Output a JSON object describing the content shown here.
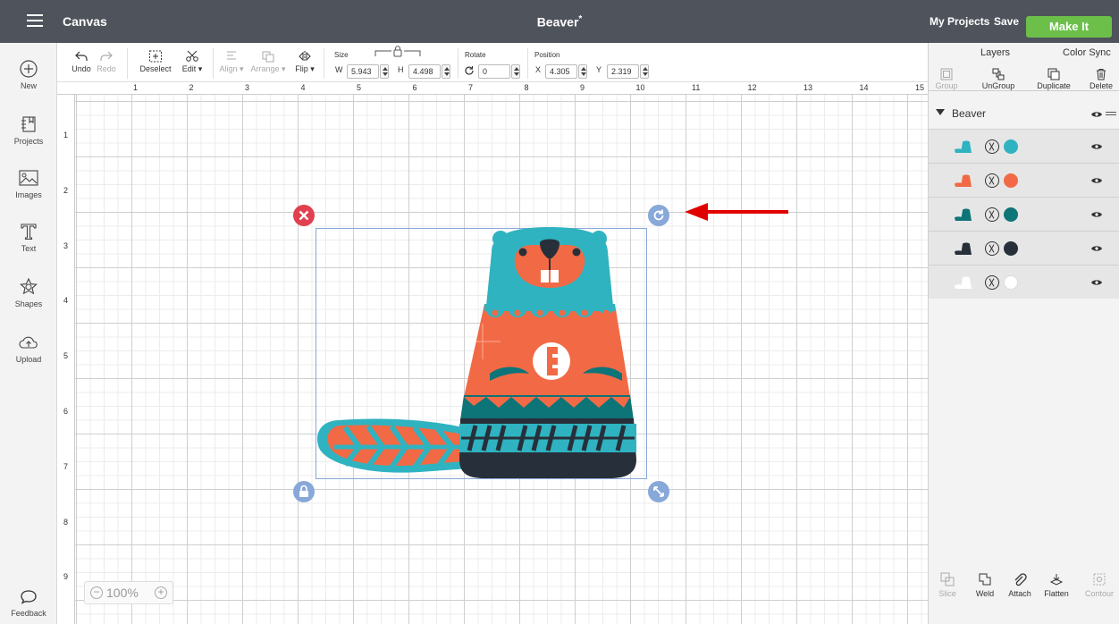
{
  "header": {
    "app_title": "Canvas",
    "doc_title": "Beaver",
    "unsaved_marker": "*",
    "my_projects": "My Projects",
    "save": "Save",
    "make_it": "Make It",
    "make_it_color": "#6cc04a"
  },
  "sidebar": {
    "items": [
      {
        "label": "New",
        "icon": "plus-circle-icon"
      },
      {
        "label": "Projects",
        "icon": "projects-icon"
      },
      {
        "label": "Images",
        "icon": "images-icon"
      },
      {
        "label": "Text",
        "icon": "text-icon"
      },
      {
        "label": "Shapes",
        "icon": "shapes-icon"
      },
      {
        "label": "Upload",
        "icon": "upload-icon"
      }
    ],
    "feedback": "Feedback"
  },
  "toolbar": {
    "undo": "Undo",
    "redo": "Redo",
    "deselect": "Deselect",
    "edit": "Edit ▾",
    "align": "Align ▾",
    "arrange": "Arrange ▾",
    "flip": "Flip ▾",
    "size_label": "Size",
    "w_label": "W",
    "w_value": "5.943",
    "h_label": "H",
    "h_value": "4.498",
    "rotate_label": "Rotate",
    "rotate_value": "0",
    "position_label": "Position",
    "x_label": "X",
    "x_value": "4.305",
    "y_label": "Y",
    "y_value": "2.319"
  },
  "rulers": {
    "top": [
      "1",
      "2",
      "3",
      "4",
      "5",
      "6",
      "7",
      "8",
      "9",
      "10",
      "11",
      "12",
      "13",
      "14",
      "15"
    ],
    "left": [
      "1",
      "2",
      "3",
      "4",
      "5",
      "6",
      "7",
      "8",
      "9"
    ]
  },
  "zoom": {
    "minus": "−",
    "value": "100%",
    "plus": "+"
  },
  "panel": {
    "tab_layers": "Layers",
    "tab_color_sync": "Color Sync",
    "tools": {
      "group": "Group",
      "ungroup": "UnGroup",
      "duplicate": "Duplicate",
      "delete": "Delete"
    },
    "group_name": "Beaver",
    "layers": [
      {
        "color": "#2fb3c0"
      },
      {
        "color": "#f26a45"
      },
      {
        "color": "#0d7478"
      },
      {
        "color": "#27303a"
      },
      {
        "color": "#ffffff"
      }
    ],
    "bottom_tools": {
      "slice": "Slice",
      "weld": "Weld",
      "attach": "Attach",
      "flatten": "Flatten",
      "contour": "Contour"
    }
  },
  "colors": {
    "teal": "#2fb3c0",
    "orange": "#f26a45",
    "dark_teal": "#0d7478",
    "dark": "#27303a",
    "handle_blue": "#87a8d8",
    "delete_red": "#e0404f",
    "annotation_arrow": "#e00000"
  }
}
